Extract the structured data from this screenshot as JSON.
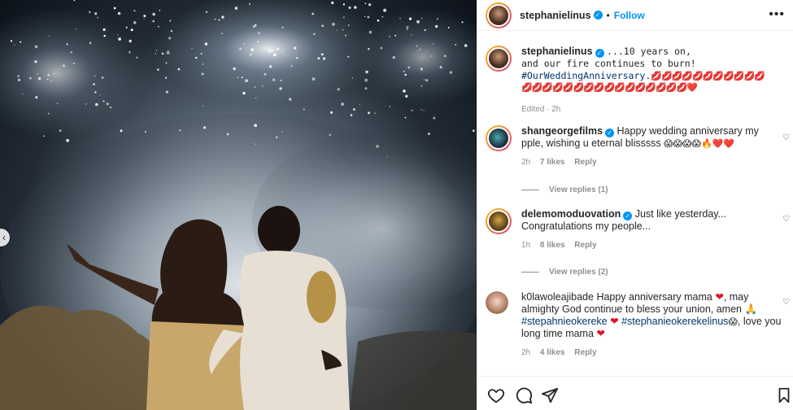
{
  "post": {
    "username": "stephanielinus",
    "follow_label": "Follow",
    "more_label": "•••",
    "dot": "•"
  },
  "caption": {
    "username": "stephanielinus",
    "line1": "...10 years on,",
    "line2": "and our fire continues to burn!",
    "hashtag": "#OurWeddingAnniversary.",
    "emoji_row1": "💋💋💋💋💋💋💋💋💋💋💋",
    "emoji_row2": "💋💋💋💋💋💋💋💋💋💋💋💋💋💋💋💋❤️",
    "time": "Edited · 2h"
  },
  "comments": [
    {
      "username": "shangeorgefilms",
      "verified": true,
      "text": "Happy wedding anniversary my pple, wishing u eternal blisssss",
      "emojis": "😱😱😱😱🔥❤️❤️",
      "time": "2h",
      "likes": "7 likes",
      "reply": "Reply",
      "view_replies": "View replies (1)"
    },
    {
      "username": "delemomoduovation",
      "verified": true,
      "text": "Just like yesterday... Congratulations my people...",
      "time": "1h",
      "likes": "8 likes",
      "reply": "Reply",
      "view_replies": "View replies (2)"
    },
    {
      "username": "k0lawoleajibade",
      "verified": false,
      "text_a": "Happy anniversary mama",
      "text_b": ", may almighty God continue to bless your union, amen",
      "hashtag1": "#stepahnieokereke",
      "hashtag2": "#stephanieokerekelinus",
      "text_c": ", love you long time mama",
      "time": "2h",
      "likes": "4 likes",
      "reply": "Reply"
    }
  ],
  "icons": [
    "heart-icon",
    "comment-icon",
    "share-icon",
    "bookmark-icon",
    "chevron-left-icon",
    "verified-badge-icon"
  ],
  "colors": {
    "link_blue": "#0095f6",
    "hashtag_blue": "#00376b",
    "meta_gray": "#8e8e8e"
  }
}
